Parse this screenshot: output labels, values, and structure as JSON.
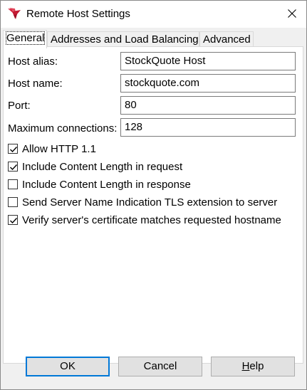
{
  "window": {
    "title": "Remote Host Settings",
    "icon": "red-winged-logo-icon",
    "close_icon": "close-icon"
  },
  "tabs": [
    {
      "label": "General",
      "active": true
    },
    {
      "label": "Addresses and Load Balancing",
      "active": false
    },
    {
      "label": "Advanced",
      "active": false
    }
  ],
  "general": {
    "host_alias": {
      "label": "Host alias:",
      "value": "StockQuote Host"
    },
    "host_name": {
      "label": "Host name:",
      "value": "stockquote.com"
    },
    "port": {
      "label": "Port:",
      "value": "80"
    },
    "max_connections": {
      "label": "Maximum connections:",
      "value": "128"
    },
    "checkboxes": [
      {
        "label": "Allow HTTP 1.1",
        "checked": true
      },
      {
        "label": "Include Content Length in request",
        "checked": true
      },
      {
        "label": "Include Content Length in response",
        "checked": false
      },
      {
        "label": "Send Server Name Indication TLS extension to server",
        "checked": false
      },
      {
        "label": "Verify server's certificate matches requested hostname",
        "checked": true
      }
    ]
  },
  "buttons": {
    "ok": "OK",
    "cancel": "Cancel",
    "help": "Help"
  },
  "colors": {
    "accent": "#0078d7",
    "icon_red": "#d6203b",
    "dialog_bg": "#f0f0f0"
  }
}
